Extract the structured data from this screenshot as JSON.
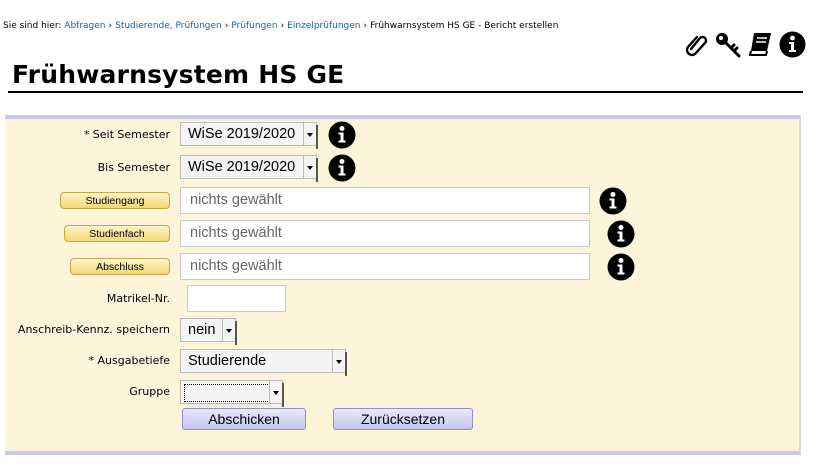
{
  "breadcrumb": {
    "prefix": "Sie sind hier:",
    "items": [
      "Abfragen",
      "Studierende, Prüfungen",
      "Prüfungen",
      "Einzelprüfungen"
    ],
    "current": "Frühwarnsystem HS GE - Bericht erstellen"
  },
  "toolbar_icons": [
    "paperclip-icon",
    "key-icon",
    "book-icon",
    "info-icon"
  ],
  "page": {
    "title": "Frühwarnsystem HS GE"
  },
  "form": {
    "seit_semester": {
      "label": "* Seit Semester",
      "value": "WiSe 2019/2020"
    },
    "bis_semester": {
      "label": "Bis Semester",
      "value": "WiSe 2019/2020"
    },
    "studiengang": {
      "button": "Studiengang",
      "placeholder": "nichts gewählt"
    },
    "studienfach": {
      "button": "Studienfach",
      "placeholder": "nichts gewählt"
    },
    "abschluss": {
      "button": "Abschluss",
      "placeholder": "nichts gewählt"
    },
    "matrikel": {
      "label": "Matrikel-Nr.",
      "value": ""
    },
    "anschreib": {
      "label": "Anschreib-Kennz. speichern",
      "value": "nein"
    },
    "ausgabetiefe": {
      "label": "* Ausgabetiefe",
      "value": "Studierende"
    },
    "gruppe": {
      "label": "Gruppe",
      "value": ""
    },
    "submit_label": "Abschicken",
    "reset_label": "Zurücksetzen"
  }
}
